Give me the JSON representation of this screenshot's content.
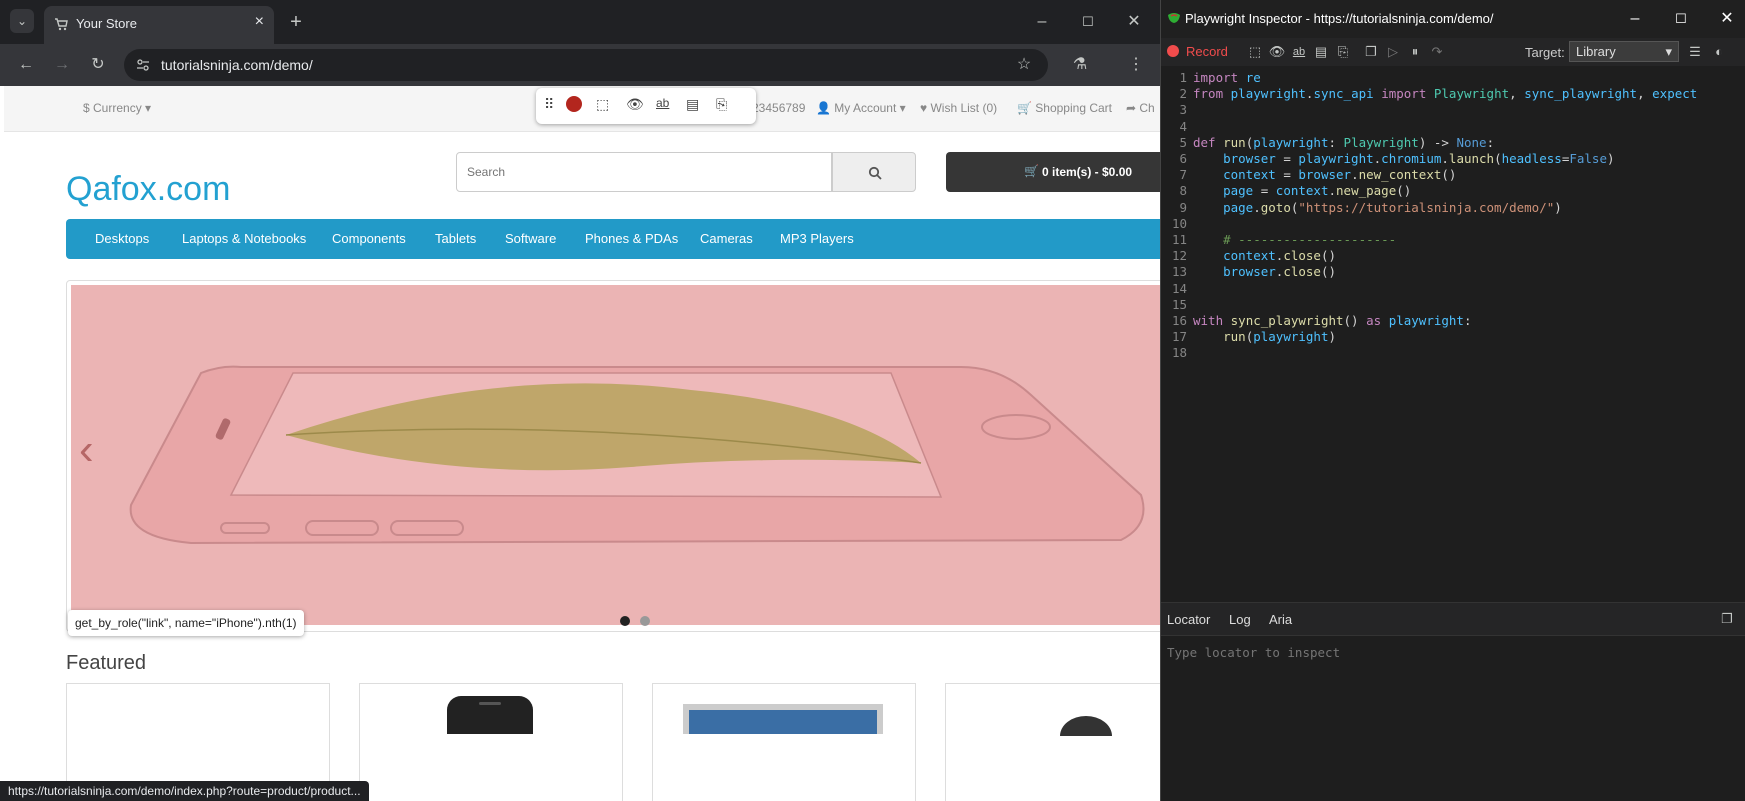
{
  "browser": {
    "tab_title": "Your Store",
    "url": "tutorialsninja.com/demo/",
    "status_url": "https://tutorialsninja.com/demo/index.php?route=product/product..."
  },
  "store": {
    "currency": "$ Currency",
    "phone": "23456789",
    "my_account": "My Account",
    "wish_list": "Wish List (0)",
    "shopping_cart": "Shopping Cart",
    "checkout": "Ch",
    "logo": "Qafox.com",
    "search_placeholder": "Search",
    "cart_label": "0 item(s) - $0.00",
    "nav": [
      "Desktops",
      "Laptops & Notebooks",
      "Components",
      "Tablets",
      "Software",
      "Phones & PDAs",
      "Cameras",
      "MP3 Players"
    ],
    "tooltip": "get_by_role(\"link\", name=\"iPhone\").nth(1)",
    "featured": "Featured"
  },
  "inspector": {
    "title": "Playwright Inspector - https://tutorialsninja.com/demo/",
    "record_label": "Record",
    "target_label": "Target:",
    "target_value": "Library",
    "tabs": [
      "Locator",
      "Log",
      "Aria"
    ],
    "locator_placeholder": "Type locator to inspect",
    "code_lines": [
      "import re",
      "from playwright.sync_api import Playwright, sync_playwright, expect",
      "",
      "",
      "def run(playwright: Playwright) -> None:",
      "    browser = playwright.chromium.launch(headless=False)",
      "    context = browser.new_context()",
      "    page = context.new_page()",
      "    page.goto(\"https://tutorialsninja.com/demo/\")",
      "",
      "    # ---------------------",
      "    context.close()",
      "    browser.close()",
      "",
      "",
      "with sync_playwright() as playwright:",
      "    run(playwright)",
      ""
    ]
  },
  "colors": {
    "brand_blue": "#229ac8",
    "record_red": "#f14c4c",
    "slide_pink": "#ebb4b4"
  }
}
